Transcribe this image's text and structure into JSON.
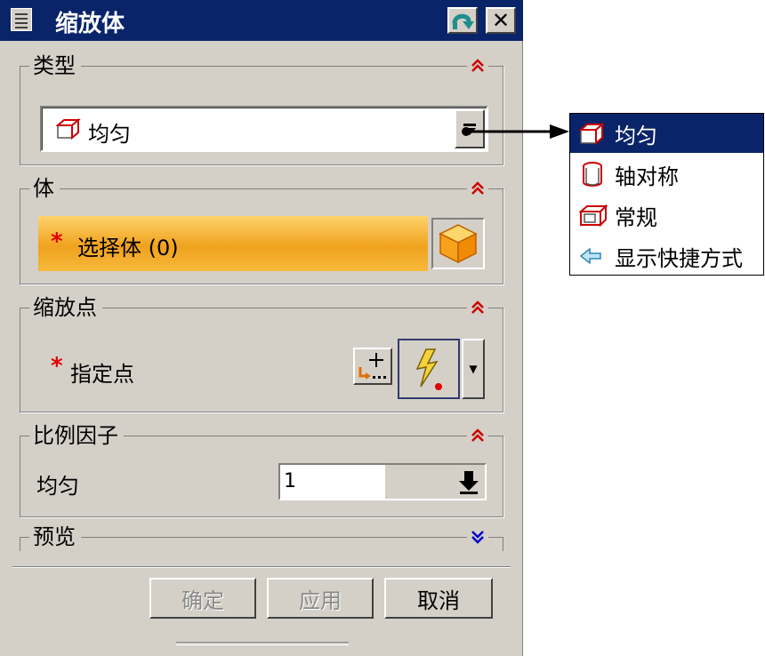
{
  "dialog": {
    "title": "缩放体",
    "icons": {
      "menu": "menu-icon",
      "back": "reset-arrow-icon",
      "close": "close-icon"
    }
  },
  "type_group": {
    "label": "类型",
    "selected": "均匀",
    "collapse_icon": "chevron-double-up-icon"
  },
  "body_group": {
    "label": "体",
    "select_label": "选择体 (0)",
    "required_mark": "*"
  },
  "point_group": {
    "label": "缩放点",
    "point_label": "指定点",
    "required_mark": "*"
  },
  "factor_group": {
    "label": "比例因子",
    "field_label": "均匀",
    "value": "1"
  },
  "preview_group": {
    "label": "预览",
    "collapse_icon": "chevron-double-down-icon"
  },
  "buttons": {
    "ok": "确定",
    "apply": "应用",
    "cancel": "取消"
  },
  "popup": {
    "items": [
      {
        "label": "均匀",
        "icon": "uniform-cube-icon",
        "selected": true
      },
      {
        "label": "轴对称",
        "icon": "cylinder-icon",
        "selected": false
      },
      {
        "label": "常规",
        "icon": "general-cube-icon",
        "selected": false
      },
      {
        "label": "显示快捷方式",
        "icon": "left-arrow-icon",
        "selected": false
      }
    ]
  },
  "colors": {
    "title_bar": "#0a246a",
    "dialog_bg": "#d4d0c8",
    "required": "#e00000",
    "select_bar": "#f0a21e",
    "collapse_up": "#cc0000",
    "collapse_down": "#0000cc"
  }
}
